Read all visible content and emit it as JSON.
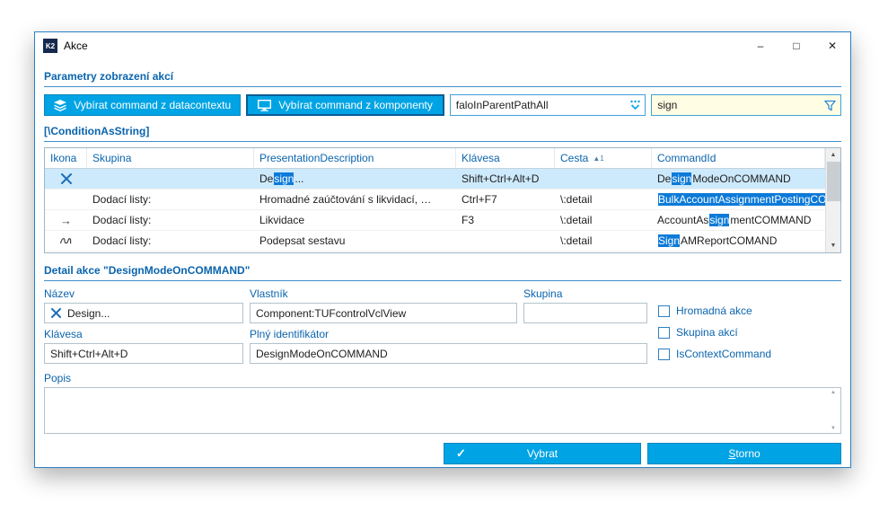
{
  "window": {
    "title": "Akce",
    "app_badge": "K2"
  },
  "icons": {
    "minimize": "–",
    "maximize": "□",
    "close": "✕",
    "arrow_right": "→",
    "check": "✓",
    "scroll_up": "▲",
    "scroll_down": "▼"
  },
  "sections": {
    "params": "Parametry zobrazení akcí",
    "condition": "[\\ConditionAsString]",
    "detail": "Detail akce \"DesignModeOnCOMMAND\""
  },
  "toolbar": {
    "datacontext_button": "Vybírat command z datacontextu",
    "component_button": "Vybírat command z komponenty",
    "path_combo_value": "faloInParentPathAll",
    "search_value": "sign"
  },
  "table": {
    "columns": {
      "ikona": "Ikona",
      "skupina": "Skupina",
      "presentation": "PresentationDescription",
      "klavesa": "Klávesa",
      "cesta": "Cesta",
      "commandid": "CommandId"
    },
    "sort": {
      "arrow": "▲",
      "order": "1"
    },
    "rows": [
      {
        "icon": "design-mode-icon",
        "skupina": "",
        "pres_pre": "De",
        "pres_hl": "sign",
        "pres_post": "...",
        "klavesa": "Shift+Ctrl+Alt+D",
        "cesta": "",
        "cmd_pre": "De",
        "cmd_hl": "sign",
        "cmd_post": "ModeOnCOMMAND"
      },
      {
        "icon": "",
        "skupina": "Dodací listy:",
        "pres_pre": "Hromadné zaúčtování s likvidací, …",
        "pres_hl": "",
        "pres_post": "",
        "klavesa": "Ctrl+F7",
        "cesta": "\\:detail",
        "cmd_pre": "",
        "cmd_hl": "BulkAccountAssignmentPostingCO…",
        "cmd_post": ""
      },
      {
        "icon": "arrow-right-icon",
        "skupina": "Dodací listy:",
        "pres_pre": "Likvidace",
        "pres_hl": "",
        "pres_post": "",
        "klavesa": "F3",
        "cesta": "\\:detail",
        "cmd_pre": "AccountAs",
        "cmd_hl": "sign",
        "cmd_post": "mentCOMMAND"
      },
      {
        "icon": "signature-icon",
        "skupina": "Dodací listy:",
        "pres_pre": "Podepsat sestavu",
        "pres_hl": "",
        "pres_post": "",
        "klavesa": "",
        "cesta": "\\:detail",
        "cmd_pre": "",
        "cmd_hl": "Sign",
        "cmd_post": "AMReportCOMAND"
      }
    ]
  },
  "detail": {
    "labels": {
      "nazev": "Název",
      "vlastnik": "Vlastník",
      "skupina": "Skupina",
      "klavesa": "Klávesa",
      "plny": "Plný identifikátor",
      "popis": "Popis"
    },
    "values": {
      "nazev": "Design...",
      "vlastnik": "Component:TUFcontrolVclView",
      "skupina": "",
      "klavesa": "Shift+Ctrl+Alt+D",
      "plny": "DesignModeOnCOMMAND",
      "popis": ""
    },
    "checkboxes": [
      {
        "label": "Hromadná akce",
        "checked": false
      },
      {
        "label": "Skupina akcí",
        "checked": false
      },
      {
        "label": "IsContextCommand",
        "checked": false
      }
    ]
  },
  "footer": {
    "vybrat": "Vybrat",
    "storno_first": "S",
    "storno_rest": "torno"
  },
  "colors": {
    "accent_cyan": "#00a4e4",
    "highlight_blue": "#0c7ad8",
    "selected_row": "#cdeafc",
    "header_blue": "#0a64ad",
    "search_bg": "#fffde3"
  }
}
